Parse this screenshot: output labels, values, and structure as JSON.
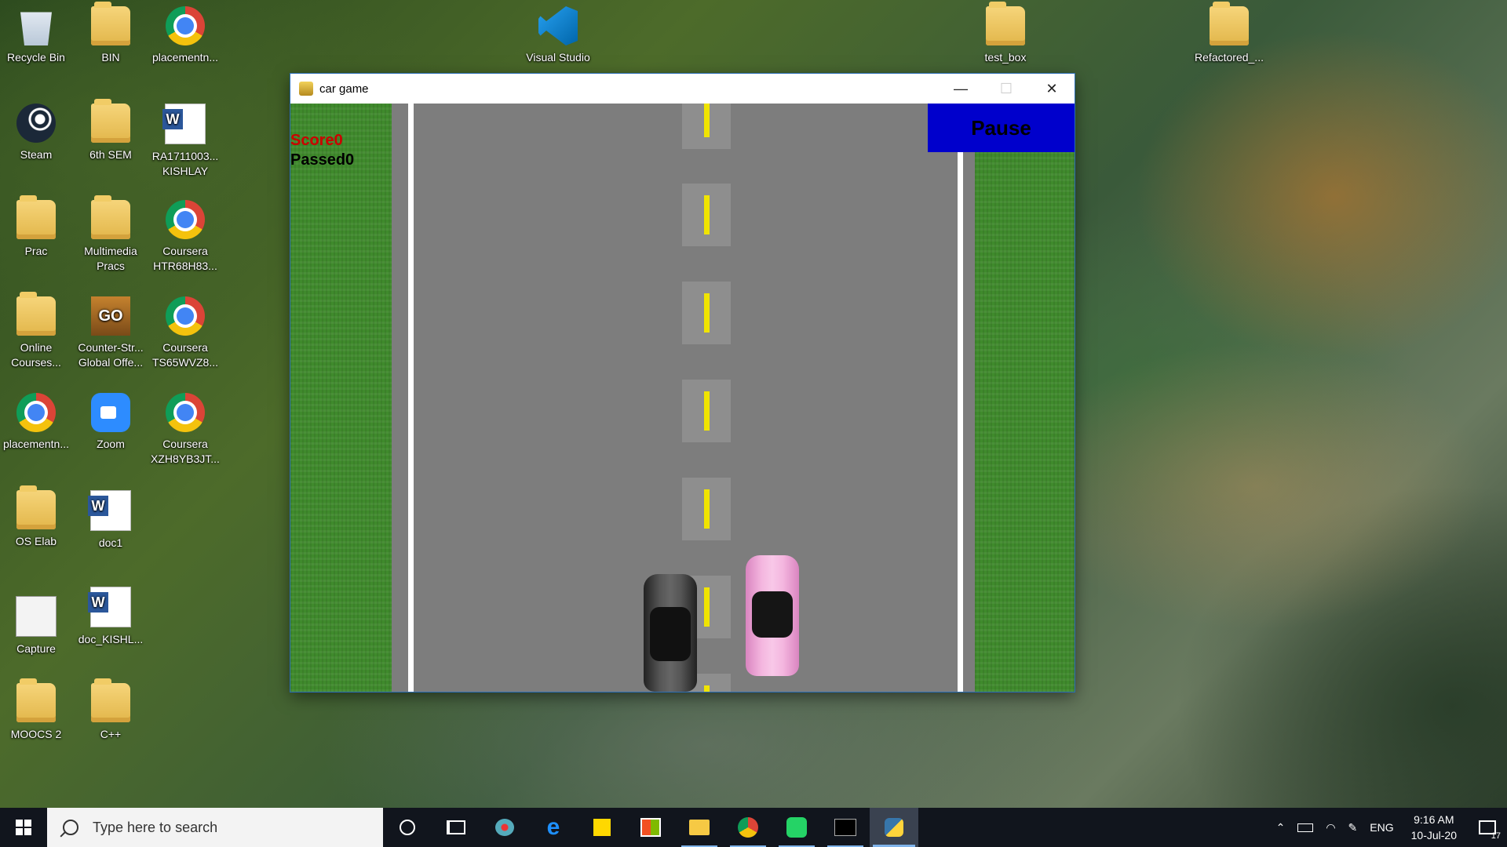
{
  "desktop": {
    "icons": [
      {
        "label": "Recycle Bin"
      },
      {
        "label": "BIN"
      },
      {
        "label": "placementn..."
      },
      {
        "label": "Steam"
      },
      {
        "label": "6th SEM"
      },
      {
        "label": "RA1711003...\nKISHLAY"
      },
      {
        "label": "Prac"
      },
      {
        "label": "Multimedia\nPracs"
      },
      {
        "label": "Coursera\nHTR68H83..."
      },
      {
        "label": "Online\nCourses..."
      },
      {
        "label": "Counter-Str...\nGlobal Offe..."
      },
      {
        "label": "Coursera\nTS65WVZ8..."
      },
      {
        "label": "placementn..."
      },
      {
        "label": "Zoom"
      },
      {
        "label": "Coursera\nXZH8YB3JT..."
      },
      {
        "label": "OS Elab"
      },
      {
        "label": "doc1"
      },
      {
        "label": "Capture"
      },
      {
        "label": "doc_KISHL..."
      },
      {
        "label": "MOOCS 2"
      },
      {
        "label": "C++"
      },
      {
        "label": "Visual Studio"
      },
      {
        "label": "test_box"
      },
      {
        "label": "Refactored_..."
      }
    ]
  },
  "window": {
    "title": "car game",
    "minimize_glyph": "—",
    "maximize_glyph": "☐",
    "close_glyph": "✕"
  },
  "game": {
    "score_label": "Score0",
    "passed_label": "Passed0",
    "pause_label": "Pause"
  },
  "taskbar": {
    "search_placeholder": "Type here to search",
    "language": "ENG",
    "time": "9:16 AM",
    "date": "10-Jul-20",
    "notification_count": "17"
  },
  "colors": {
    "grass": "#3f8a2c",
    "road": "#7d7d7d",
    "lane": "#f0e400",
    "pause_bg": "#0000cc",
    "score_text": "#cc0000"
  }
}
